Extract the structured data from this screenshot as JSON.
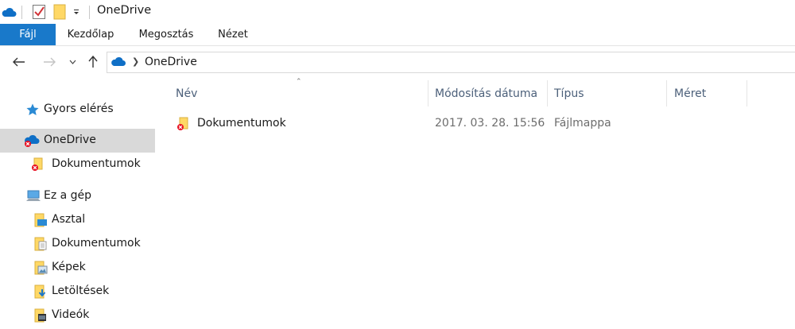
{
  "window": {
    "title": "OneDrive"
  },
  "quick_access": {
    "icons": [
      "onedrive-cloud-icon",
      "properties-check-icon",
      "new-folder-icon",
      "customize-dropdown-icon"
    ]
  },
  "ribbon": {
    "tabs": [
      {
        "label": "Fájl"
      },
      {
        "label": "Kezdőlap"
      },
      {
        "label": "Megosztás"
      },
      {
        "label": "Nézet"
      }
    ]
  },
  "address": {
    "crumb": "OneDrive"
  },
  "nav": {
    "items": [
      {
        "label": "Gyors elérés",
        "icon": "star-icon"
      },
      {
        "label": "OneDrive",
        "icon": "onedrive-cloud-icon"
      },
      {
        "label": "Dokumentumok",
        "icon": "folder-icon"
      },
      {
        "label": "Ez a gép",
        "icon": "computer-icon"
      },
      {
        "label": "Asztal",
        "icon": "desktop-folder-icon"
      },
      {
        "label": "Dokumentumok",
        "icon": "documents-folder-icon"
      },
      {
        "label": "Képek",
        "icon": "pictures-folder-icon"
      },
      {
        "label": "Letöltések",
        "icon": "downloads-folder-icon"
      },
      {
        "label": "Videók",
        "icon": "videos-folder-icon"
      }
    ]
  },
  "table": {
    "columns": [
      "Név",
      "Módosítás dátuma",
      "Típus",
      "Méret"
    ],
    "rows": [
      {
        "name": "Dokumentumok",
        "modified": "2017. 03. 28. 15:56",
        "type": "Fájlmappa",
        "size": ""
      }
    ]
  },
  "colors": {
    "accent": "#1979ca",
    "selection": "#d9d9d9",
    "header_text": "#4c607a",
    "error_badge": "#e81123"
  }
}
